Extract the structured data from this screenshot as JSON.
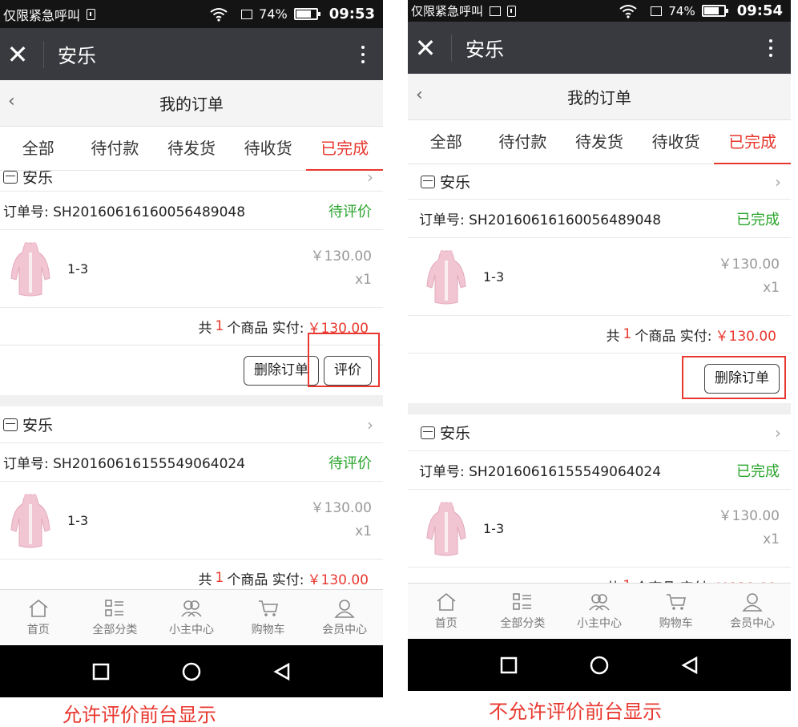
{
  "status_bar": {
    "left": {
      "carrier": "仅限紧急呼叫",
      "time": "09:53",
      "battery": "74%"
    },
    "right": {
      "carrier": "仅限紧急呼叫",
      "time": "09:54",
      "battery": "74%"
    },
    "battery_level": 0.74
  },
  "titlebar": {
    "close_icon": "close-icon",
    "shop_name": "安乐",
    "more_icon": "more-vertical-icon"
  },
  "navbar": {
    "back_icon": "chevron-left-icon",
    "title": "我的订单"
  },
  "tabs": [
    "全部",
    "待付款",
    "待发货",
    "待收货",
    "已完成"
  ],
  "active_tab": "已完成",
  "orders": [
    {
      "shop": "安乐",
      "order_no": "订单号: SH20160616160056489048",
      "spec": "1-3",
      "price": "￥130.00",
      "qty": "x1",
      "summary_prefix": "共",
      "count": "1",
      "summary_mid": "个商品 实付:",
      "total": "￥130.00"
    },
    {
      "shop": "安乐",
      "order_no": "订单号: SH20160616155549064024",
      "spec": "1-3",
      "price": "￥130.00",
      "qty": "x1",
      "summary_prefix": "共",
      "count": "1",
      "summary_mid": "个商品 实付:",
      "total": "￥130.00"
    }
  ],
  "left_phone": {
    "status": "待评价",
    "delete_btn": "删除订单",
    "review_btn": "评价"
  },
  "right_phone": {
    "status": "已完成",
    "delete_btn": "删除订单"
  },
  "tabbar": [
    "首页",
    "全部分类",
    "小主中心",
    "购物车",
    "会员中心"
  ],
  "captions": {
    "left": "允许评价前台显示",
    "right": "不允许评价前台显示"
  },
  "colors": {
    "accent_red": "#e8382f",
    "status_green": "#2aa42c",
    "titlebar": "#393a3f"
  }
}
